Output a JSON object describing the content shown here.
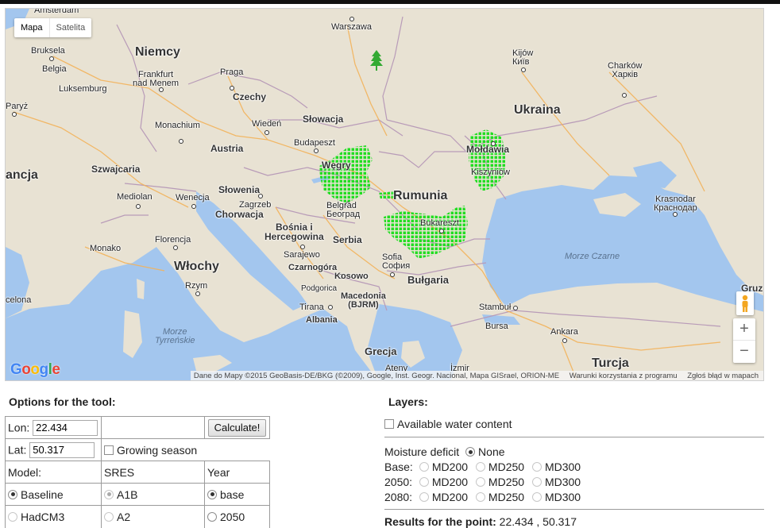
{
  "map": {
    "type_buttons": {
      "map": "Mapa",
      "satellite": "Satelita"
    },
    "labels": {
      "amsterdam": "Amsterdam",
      "warszawa": "Warszawa",
      "bruksela": "Bruksela",
      "belgia": "Belgia",
      "niemcy": "Niemcy",
      "frankfurt": "Frankfurt\nnad Menem",
      "luksemburg": "Luksemburg",
      "praga": "Praga",
      "paryz": "Paryż",
      "czechy": "Czechy",
      "monachium": "Monachium",
      "wieden": "Wiedeń",
      "slowacja": "Słowacja",
      "kijow": "Kijów\nКиїв",
      "charkow": "Charków\nХарків",
      "ukraina": "Ukraina",
      "moldawia": "Mołdawia",
      "kiszyniow": "Kiszyniów",
      "budapeszt": "Budapeszt",
      "austria": "Austria",
      "wegry": "Węgry",
      "francja": "ancja",
      "szwajcaria": "Szwajcaria",
      "mediolan": "Mediolan",
      "wenecja": "Wenecja",
      "slowenia": "Słowenia",
      "zagrzeb": "Zagrzeb",
      "chorwacja": "Chorwacja",
      "belgrad": "Belgrad\nБеоград",
      "rumunia": "Rumunia",
      "krasnodar": "Krasnodar\nКраснодар",
      "bosnia": "Bośnia i\nHercegowina",
      "serbia": "Serbia",
      "bukareszt": "Bukareszt",
      "florencja": "Florencja",
      "monako": "Monako",
      "wlochy": "Włochy",
      "sarajewo": "Sarajewo",
      "czarnogora": "Czarnogóra",
      "sofia": "Sofia\nСофия",
      "morze_czarne": "Morze Czarne",
      "podgorica": "Podgorica",
      "kosowo": "Kosowo",
      "bulgaria": "Bułgaria",
      "rzym": "Rzym",
      "macedonia": "Macedonia\n(BJRM)",
      "barcelona": "celona",
      "tirana": "Tirana",
      "stambul": "Stambuł",
      "albania": "Albania",
      "bursa": "Bursa",
      "ankara": "Ankara",
      "morze_tyrrenskie": "Morze\nTyrreńskie",
      "grecja": "Grecja",
      "turcja": "Turcja",
      "gruzja": "Gruz",
      "ateny": "Ateny",
      "izmir": "İzmir"
    },
    "attribution": {
      "data": "Dane do Mapy ©2015 GeoBasis-DE/BKG (©2009), Google, Inst. Geogr. Nacional, Mapa GISrael, ORION-ME",
      "terms": "Warunki korzystania z programu",
      "report": "Zgłoś błąd w mapach"
    },
    "zoom": {
      "in": "+",
      "out": "−"
    },
    "colors": {
      "land": "#e8e2d3",
      "water": "#a3c6ee",
      "data_points": "#22dd22",
      "marker": "#33aa33"
    }
  },
  "options": {
    "title": "Options for the tool:",
    "lon_label": "Lon:",
    "lon_value": "22.434",
    "lat_label": "Lat:",
    "lat_value": "50.317",
    "calculate": "Calculate!",
    "growing_season": "Growing season",
    "col_model": "Model:",
    "col_sres": "SRES",
    "col_year": "Year",
    "model_baseline": "Baseline",
    "model_hadcm3": "HadCM3",
    "sres_a1b": "A1B",
    "sres_a2": "A2",
    "year_base": "base",
    "year_2050": "2050"
  },
  "layers": {
    "title": "Layers:",
    "available_water": "Available water content",
    "moisture_deficit": "Moisture deficit",
    "none": "None",
    "years": [
      "Base:",
      "2050:",
      "2080:"
    ],
    "md_options": [
      "MD200",
      "MD250",
      "MD300"
    ],
    "results_label": "Results for the point:",
    "results_value": "22.434 , 50.317"
  }
}
